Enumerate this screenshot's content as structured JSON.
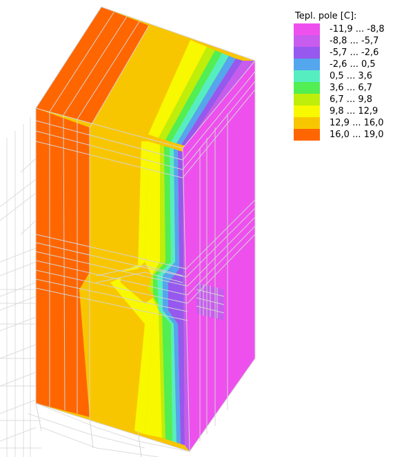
{
  "legend": {
    "title": "Tepl. pole [C]:",
    "items": [
      {
        "label": "-11,9 ... -8,8",
        "color": "#EE50EE"
      },
      {
        "label": "-8,8 ... -5,7",
        "color": "#C85CEE"
      },
      {
        "label": "-5,7 ... -2,6",
        "color": "#9658EE"
      },
      {
        "label": "-2,6 ... 0,5",
        "color": "#54A6EE"
      },
      {
        "label": "0,5 ... 3,6",
        "color": "#56EEC0"
      },
      {
        "label": "3,6 ... 6,7",
        "color": "#52EE52"
      },
      {
        "label": "6,7 ... 9,8",
        "color": "#BEEE0A"
      },
      {
        "label": "9,8 ... 12,9",
        "color": "#F8F800"
      },
      {
        "label": "12,9 ... 16,0",
        "color": "#F8C600"
      },
      {
        "label": "16,0 ... 19,0",
        "color": "#FF6600"
      }
    ]
  }
}
